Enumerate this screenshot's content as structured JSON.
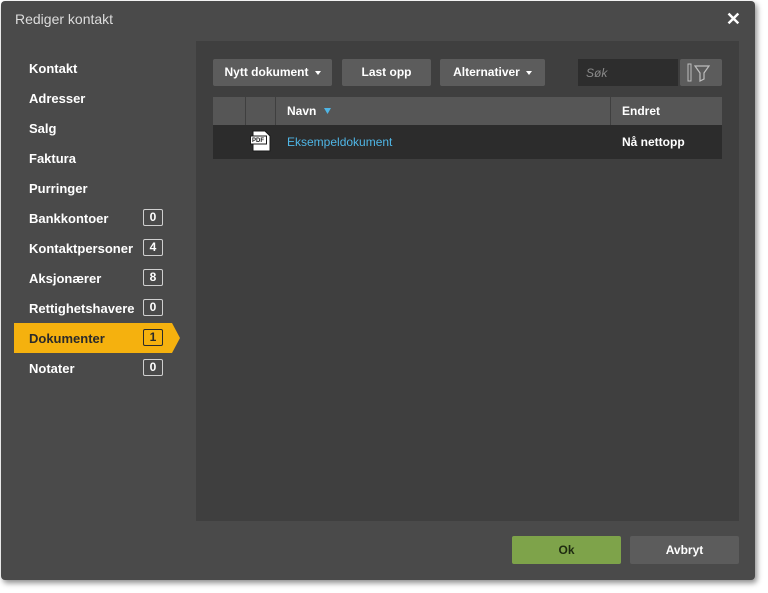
{
  "dialog": {
    "title": "Rediger kontakt",
    "close_glyph": "✕"
  },
  "sidebar": {
    "items": [
      {
        "label": "Kontakt",
        "badge": null
      },
      {
        "label": "Adresser",
        "badge": null
      },
      {
        "label": "Salg",
        "badge": null
      },
      {
        "label": "Faktura",
        "badge": null
      },
      {
        "label": "Purringer",
        "badge": null
      },
      {
        "label": "Bankkontoer",
        "badge": "0"
      },
      {
        "label": "Kontaktpersoner",
        "badge": "4"
      },
      {
        "label": "Aksjonærer",
        "badge": "8"
      },
      {
        "label": "Rettighetshavere",
        "badge": "0"
      },
      {
        "label": "Dokumenter",
        "badge": "1",
        "active": true
      },
      {
        "label": "Notater",
        "badge": "0"
      }
    ]
  },
  "toolbar": {
    "new_document": "Nytt dokument",
    "upload": "Last opp",
    "options": "Alternativer",
    "search_placeholder": "Søk"
  },
  "table": {
    "columns": {
      "name": "Navn",
      "changed": "Endret"
    },
    "rows": [
      {
        "file_type_label": "PDF",
        "name": "Eksempeldokument",
        "changed": "Nå nettopp"
      }
    ]
  },
  "footer": {
    "ok": "Ok",
    "cancel": "Avbryt"
  },
  "colors": {
    "dialog_bg": "#4a4a4a",
    "panel_bg": "#3f3f3f",
    "active_item": "#f5b10e",
    "ok_button": "#7ea34a",
    "link": "#4fb6e6"
  },
  "icons": {
    "sort": "triangle-down-icon",
    "filter": "funnel-icon",
    "file": "pdf-file-icon"
  }
}
